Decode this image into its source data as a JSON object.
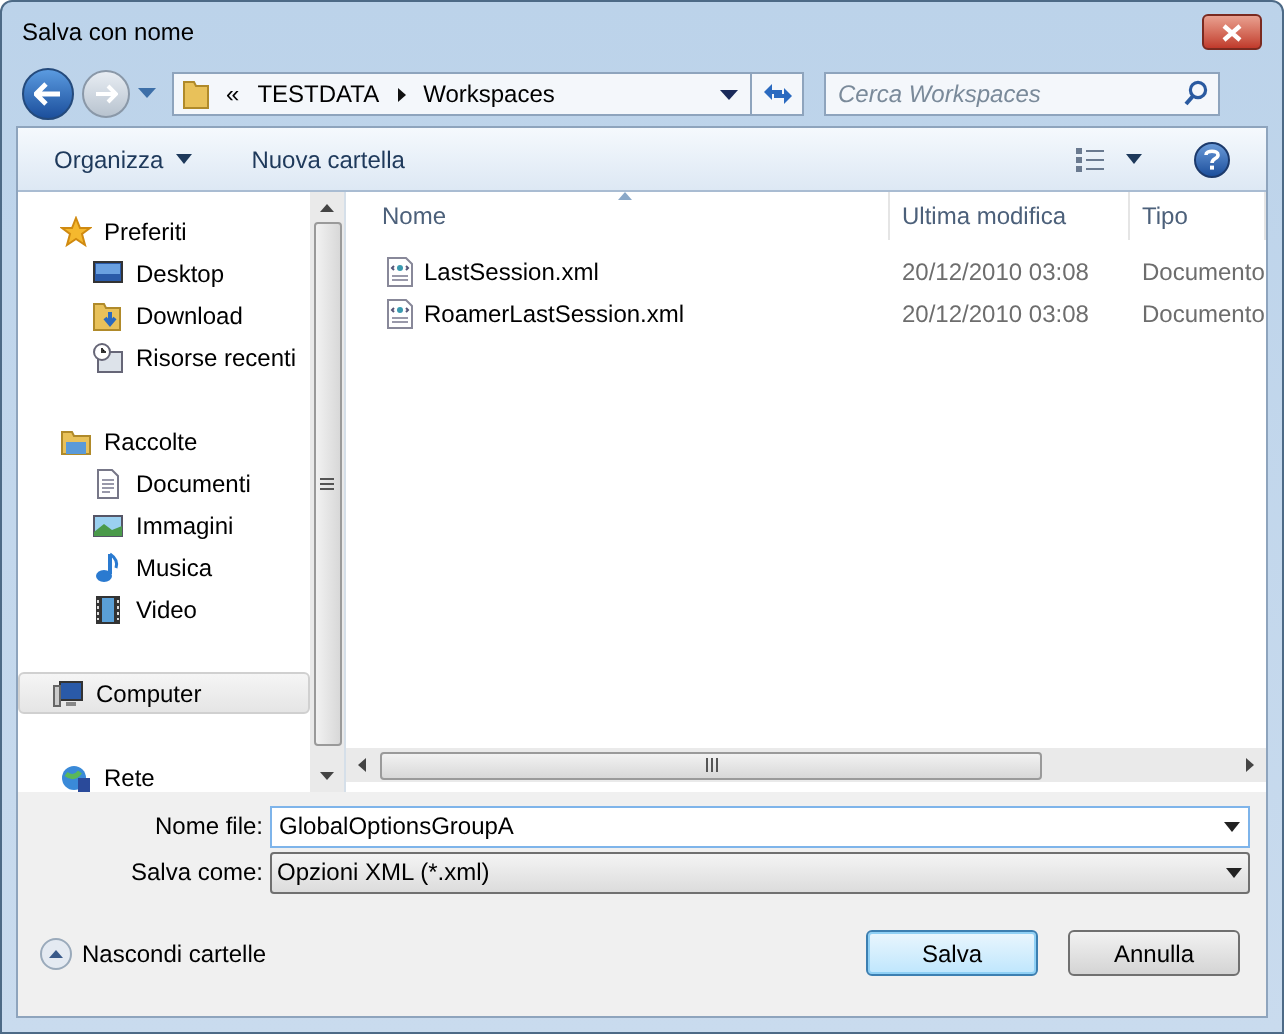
{
  "window": {
    "title": "Salva con nome"
  },
  "address": {
    "overflow": "«",
    "path": [
      "TESTDATA",
      "Workspaces"
    ]
  },
  "search": {
    "placeholder": "Cerca Workspaces"
  },
  "toolbar": {
    "organize": "Organizza",
    "new_folder": "Nuova cartella"
  },
  "sidebar": {
    "groups": [
      {
        "label": "Preferiti",
        "kind": "star",
        "selected": false,
        "children": [
          {
            "label": "Desktop",
            "kind": "desktop",
            "selected": false
          },
          {
            "label": "Download",
            "kind": "download",
            "selected": false
          },
          {
            "label": "Risorse recenti",
            "kind": "recent",
            "selected": false
          }
        ]
      },
      {
        "label": "Raccolte",
        "kind": "library",
        "selected": false,
        "children": [
          {
            "label": "Documenti",
            "kind": "documents",
            "selected": false
          },
          {
            "label": "Immagini",
            "kind": "pictures",
            "selected": false
          },
          {
            "label": "Musica",
            "kind": "music",
            "selected": false
          },
          {
            "label": "Video",
            "kind": "video",
            "selected": false
          }
        ]
      },
      {
        "label": "Computer",
        "kind": "computer",
        "selected": true
      },
      {
        "label": "Rete",
        "kind": "network",
        "selected": false
      }
    ]
  },
  "file_list": {
    "columns": [
      {
        "label": "Nome",
        "sorted": true
      },
      {
        "label": "Ultima modifica",
        "sorted": false
      },
      {
        "label": "Tipo",
        "sorted": false
      }
    ],
    "rows": [
      {
        "name": "LastSession.xml",
        "modified": "20/12/2010 03:08",
        "type": "Documento"
      },
      {
        "name": "RoamerLastSession.xml",
        "modified": "20/12/2010 03:08",
        "type": "Documento"
      }
    ]
  },
  "form": {
    "file_name": {
      "label": "Nome file:",
      "value": "GlobalOptionsGroupA"
    },
    "save_as": {
      "label": "Salva come:",
      "value": "Opzioni XML (*.xml)"
    }
  },
  "hide_folders": "Nascondi cartelle",
  "buttons": [
    {
      "label": "Salva",
      "default": true
    },
    {
      "label": "Annulla",
      "default": false
    }
  ]
}
